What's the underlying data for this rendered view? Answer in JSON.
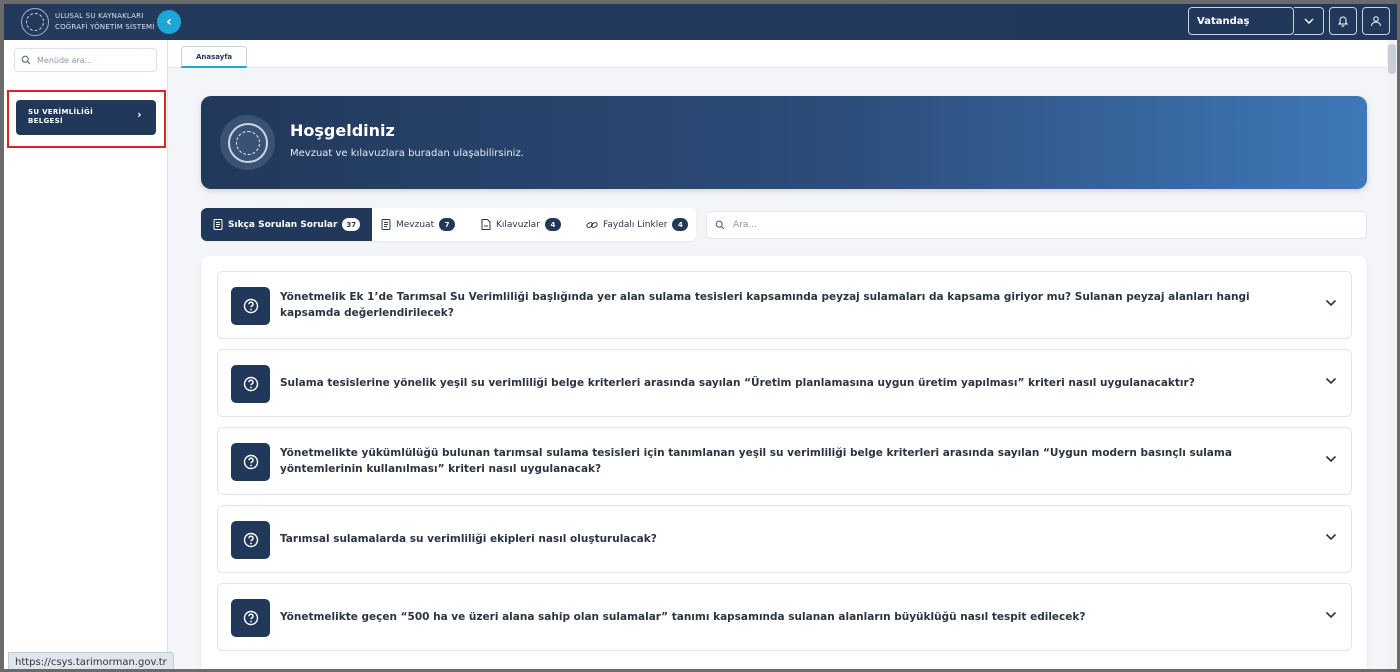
{
  "header": {
    "brand_line1": "ULUSAL SU KAYNAKLARI",
    "brand_line2": "COĞRAFİ YÖNETİM SİSTEMİ",
    "role_selected": "Vatandaş",
    "icons": [
      "chevron-left-icon",
      "chevron-down-icon",
      "bell-icon",
      "user-icon"
    ]
  },
  "sidebar": {
    "search_placeholder": "Menüde ara...",
    "items": [
      {
        "label_line1": "SU VERİMLİLİĞİ",
        "label_line2": "BELGESİ"
      }
    ]
  },
  "tabs": [
    {
      "label": "Anasayfa"
    }
  ],
  "hero": {
    "title": "Hoşgeldiniz",
    "subtitle": "Mevzuat ve kılavuzlara buradan ulaşabilirsiniz."
  },
  "filter_tabs": [
    {
      "label": "Sıkça Sorulan Sorular",
      "count": "37"
    },
    {
      "label": "Mevzuat",
      "count": "7"
    },
    {
      "label": "Kılavuzlar",
      "count": "4"
    },
    {
      "label": "Faydalı Linkler",
      "count": "4"
    }
  ],
  "search": {
    "placeholder": "Ara..."
  },
  "faq": [
    {
      "question": "Yönetmelik Ek 1’de Tarımsal Su Verimliliği başlığında yer alan sulama tesisleri kapsamında peyzaj sulamaları da kapsama giriyor mu? Sulanan peyzaj alanları hangi kapsamda değerlendirilecek?"
    },
    {
      "question": "Sulama tesislerine yönelik yeşil su verimliliği belge kriterleri arasında sayılan “Üretim planlamasına uygun üretim yapılması” kriteri nasıl uygulanacaktır?"
    },
    {
      "question": "Yönetmelikte yükümlülüğü bulunan tarımsal sulama tesisleri için tanımlanan yeşil su verimliliği belge kriterleri arasında sayılan “Uygun modern basınçlı sulama yöntemlerinin kullanılması” kriteri nasıl uygulanacak?"
    },
    {
      "question": "Tarımsal sulamalarda su verimliliği ekipleri nasıl oluşturulacak?"
    },
    {
      "question": "Yönetmelikte geçen “500 ha ve üzeri alana sahip olan sulamalar” tanımı kapsamında sulanan alanların büyüklüğü nasıl tespit edilecek?"
    }
  ],
  "statusbar": {
    "url": "https://csys.tarimorman.gov.tr"
  },
  "colors": {
    "navy": "#22385b",
    "accent": "#1ea7d6",
    "highlight": "#d9252a"
  }
}
